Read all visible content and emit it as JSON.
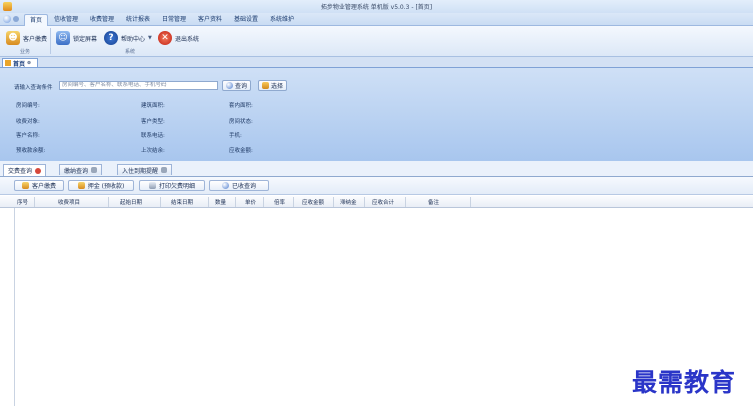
{
  "window": {
    "title": "拓步物业管理系统 单机版 v5.0.3 - [首页]"
  },
  "menu": {
    "tabs": [
      {
        "label": "首页",
        "active": true
      },
      {
        "label": "信收管理"
      },
      {
        "label": "收费管理"
      },
      {
        "label": "统计报表"
      },
      {
        "label": "日常管理"
      },
      {
        "label": "客户资料"
      },
      {
        "label": "基础设置"
      },
      {
        "label": "系统维护"
      }
    ]
  },
  "ribbon": {
    "customer_fee": "客户缴费",
    "lock_screen": "锁定屏幕",
    "help_center": "帮助中心",
    "exit_system": "退出系统",
    "group_business": "业务",
    "group_system": "系统"
  },
  "doc_tab": {
    "label": "首页"
  },
  "query": {
    "label": "请输入查询条件",
    "placeholder": "房间编号、客户名称、联系电话、手机号码",
    "search_button": "查询",
    "select_button": "选择"
  },
  "info_fields": {
    "room_no": "房间编号:",
    "building_area": "建筑面积:",
    "inner_area": "套内面积:",
    "charge_target": "收费对象:",
    "customer_type": "客户类型:",
    "room_status": "房间状态:",
    "customer_name": "客户名称:",
    "contact_phone": "联系电话:",
    "mobile": "手机:",
    "deposit_balance": "预收款余额:",
    "last_settlement": "上次结余:",
    "receivable_total": "应收金额:"
  },
  "bottom_tabs": [
    {
      "label": "交费查询",
      "active": true
    },
    {
      "label": "缴纳查询"
    },
    {
      "label": "入住到期提醒"
    }
  ],
  "toolbar": {
    "customer_fee": "客户缴费",
    "deposit": "押金 (预收款)",
    "print_detail": "打印欠费明细",
    "receivable_query": "已收查询"
  },
  "grid": {
    "columns": [
      "序号",
      "收费项目",
      "起始日期",
      "结束日期",
      "数量",
      "单价",
      "倍率",
      "应收金额",
      "滞纳金",
      "应收合计",
      "备注"
    ]
  },
  "watermark": "最需教育"
}
